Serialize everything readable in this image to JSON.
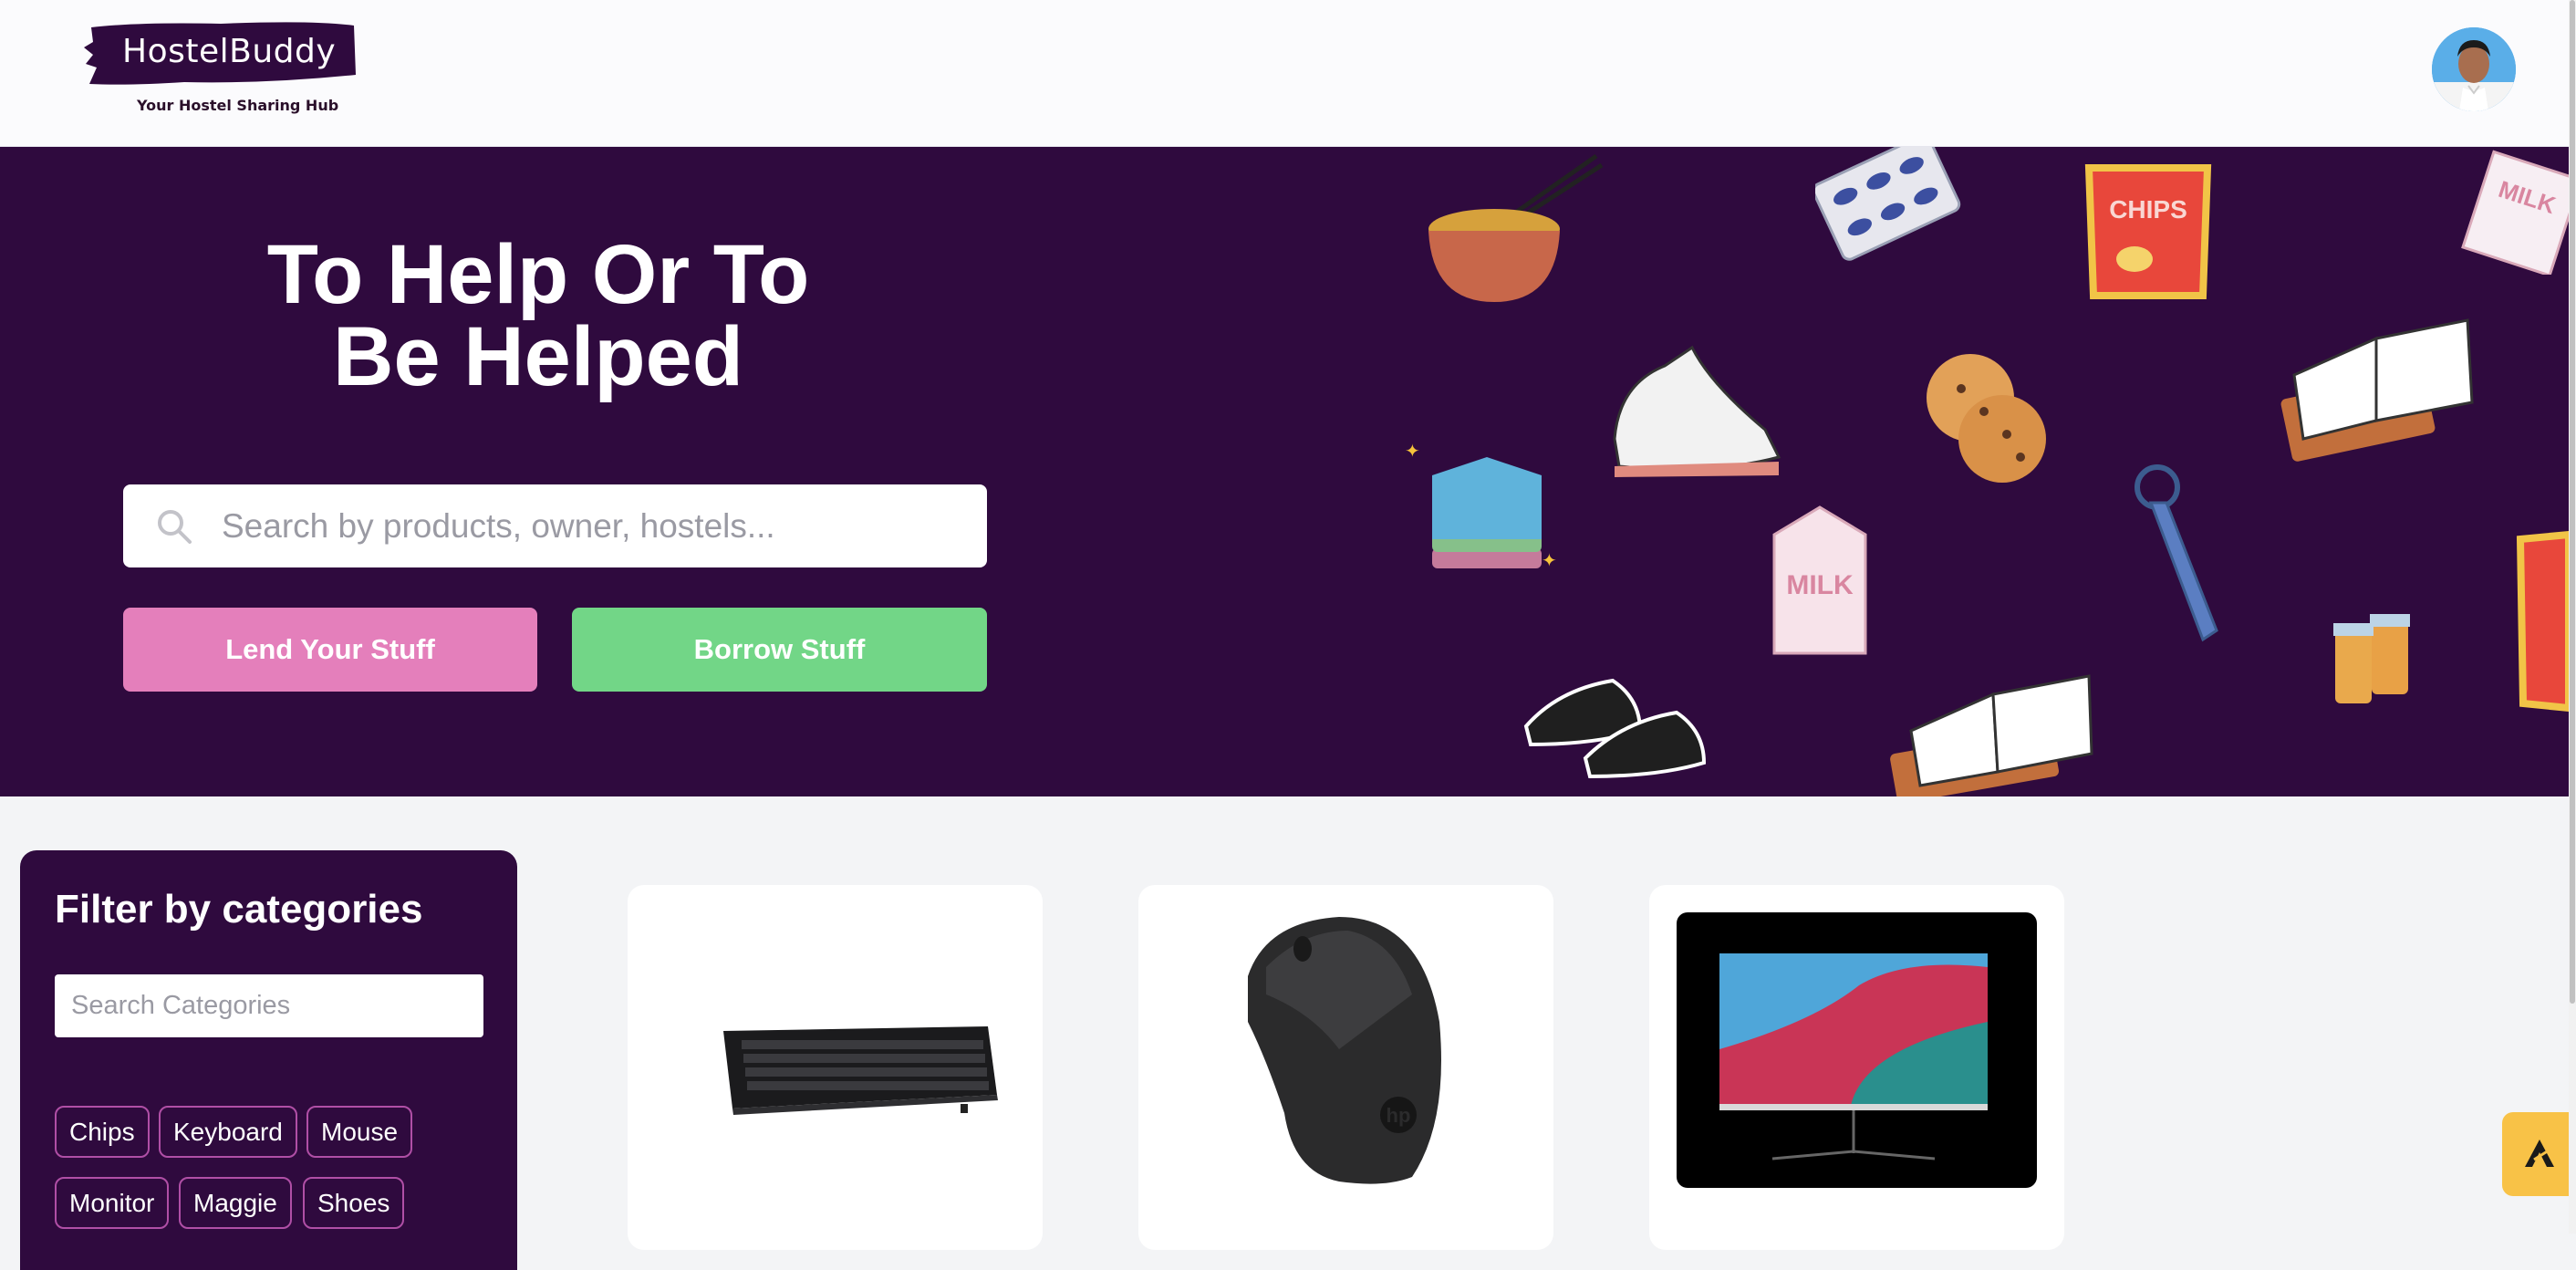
{
  "header": {
    "logo_name": "HostelBuddy",
    "logo_tagline": "Your Hostel Sharing Hub"
  },
  "hero": {
    "title_line1": "To Help Or To",
    "title_line2": "Be Helped",
    "search_placeholder": "Search by products, owner, hostels...",
    "lend_button": "Lend Your Stuff",
    "borrow_button": "Borrow Stuff",
    "art_labels": {
      "chips": "CHIPS",
      "milk": "MILK"
    }
  },
  "filter": {
    "title": "Filter by categories",
    "search_placeholder": "Search Categories",
    "categories": [
      "Chips",
      "Keyboard",
      "Mouse",
      "Monitor",
      "Maggie",
      "Shoes"
    ]
  },
  "products": [
    {
      "icon": "keyboard-image"
    },
    {
      "icon": "mouse-image"
    },
    {
      "icon": "monitor-image"
    }
  ],
  "colors": {
    "brand_purple": "#2f0a3e",
    "lend_pink": "#e47fbb",
    "borrow_green": "#72d687",
    "help_yellow": "#f8c247"
  }
}
